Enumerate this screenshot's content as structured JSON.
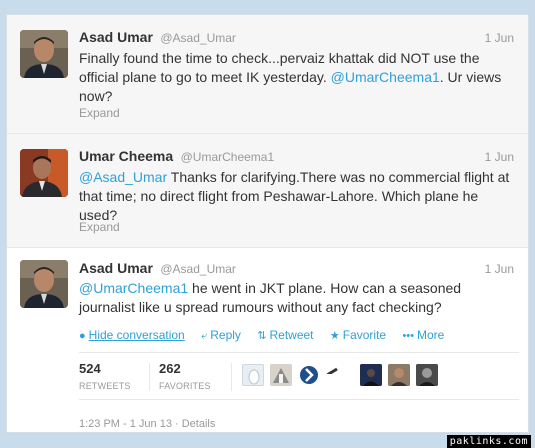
{
  "tweets": [
    {
      "fullname": "Asad Umar",
      "username": "@Asad_Umar",
      "time": "1 Jun",
      "text_parts": [
        "Finally found the time to check...pervaiz khattak did NOT use the official plane to go to meet IK yesterday. ",
        "@UmarCheema1",
        ". Ur views now?"
      ],
      "expand": "Expand"
    },
    {
      "fullname": "Umar Cheema",
      "username": "@UmarCheema1",
      "time": "1 Jun",
      "text_parts": [
        "@Asad_Umar",
        " Thanks for clarifying.There was no commercial flight at that time; no direct flight from Peshawar-Lahore. Which plane he used?"
      ],
      "expand": "Expand"
    },
    {
      "fullname": "Asad Umar",
      "username": "@Asad_Umar",
      "time": "1 Jun",
      "text_parts": [
        "@UmarCheema1",
        " he went in JKT plane. How can a seasoned journalist like u spread rumours without any fact checking?"
      ],
      "actions": {
        "hide": "Hide conversation",
        "reply": "Reply",
        "retweet": "Retweet",
        "favorite": "Favorite",
        "more": "More"
      },
      "stats": {
        "retweets": "524",
        "retweets_label": "RETWEETS",
        "favorites": "262",
        "favorites_label": "FAVORITES"
      },
      "details": "1:23 PM - 1 Jun 13 · Details"
    }
  ],
  "watermark": "paklinks.com",
  "colors": {
    "link": "#2fa0d8",
    "muted": "#999999",
    "text": "#333333",
    "collapsed_bg": "#f6f6f6",
    "page_bg": "#c9dcec"
  },
  "icons": {
    "reply": "reply-arrow-icon",
    "retweet": "retweet-icon",
    "favorite": "star-icon",
    "more": "more-dots-icon",
    "hide": "chat-bubble-icon"
  }
}
